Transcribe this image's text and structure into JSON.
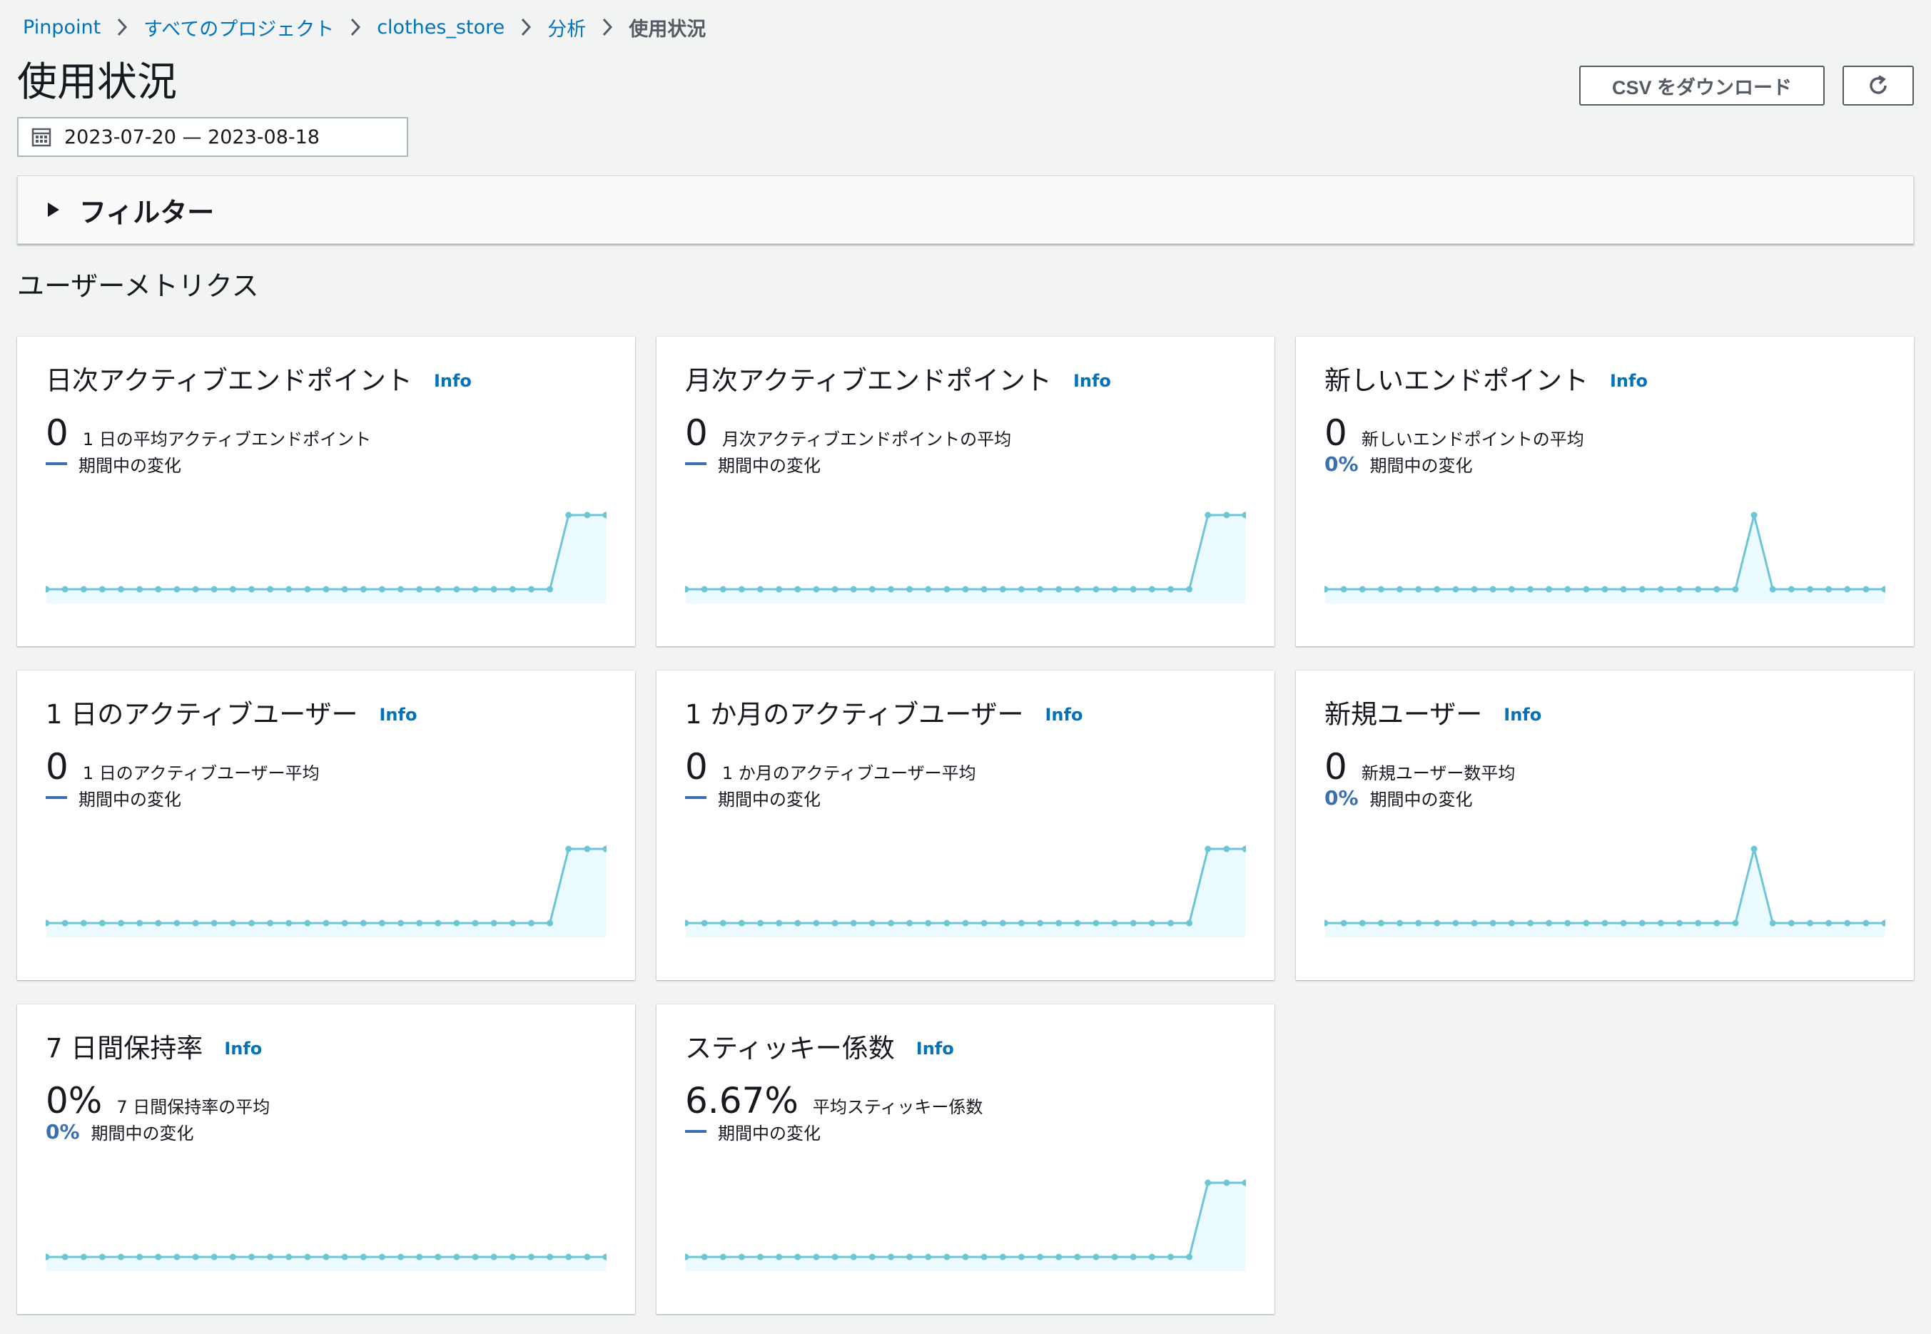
{
  "breadcrumb": [
    {
      "label": "Pinpoint"
    },
    {
      "label": "すべてのプロジェクト"
    },
    {
      "label": "clothes_store"
    },
    {
      "label": "分析"
    }
  ],
  "breadcrumb_current": "使用状況",
  "page_title": "使用状況",
  "buttons": {
    "csv": "CSV をダウンロード"
  },
  "date_range": "2023-07-20 — 2023-08-18",
  "filter_label": "フィルター",
  "section_title": "ユーザーメトリクス",
  "info_label": "Info",
  "colors": {
    "line": "#6cc6d6",
    "fill": "#eafaff",
    "accent": "#3a6fb0",
    "link": "#0073bb"
  },
  "cards": [
    {
      "title": "日次アクティブエンドポイント",
      "value": "0",
      "desc": "1 日の平均アクティブエンドポイント",
      "change": "",
      "change_label": "期間中の変化",
      "series": [
        0,
        0,
        0,
        0,
        0,
        0,
        0,
        0,
        0,
        0,
        0,
        0,
        0,
        0,
        0,
        0,
        0,
        0,
        0,
        0,
        0,
        0,
        0,
        0,
        0,
        0,
        0,
        0,
        1,
        1,
        1
      ]
    },
    {
      "title": "月次アクティブエンドポイント",
      "value": "0",
      "desc": "月次アクティブエンドポイントの平均",
      "change": "",
      "change_label": "期間中の変化",
      "series": [
        0,
        0,
        0,
        0,
        0,
        0,
        0,
        0,
        0,
        0,
        0,
        0,
        0,
        0,
        0,
        0,
        0,
        0,
        0,
        0,
        0,
        0,
        0,
        0,
        0,
        0,
        0,
        0,
        1,
        1,
        1
      ]
    },
    {
      "title": "新しいエンドポイント",
      "value": "0",
      "desc": "新しいエンドポイントの平均",
      "change": "0%",
      "change_label": "期間中の変化",
      "series": [
        0,
        0,
        0,
        0,
        0,
        0,
        0,
        0,
        0,
        0,
        0,
        0,
        0,
        0,
        0,
        0,
        0,
        0,
        0,
        0,
        0,
        0,
        0,
        1,
        0,
        0,
        0,
        0,
        0,
        0,
        0
      ]
    },
    {
      "title": "1 日のアクティブユーザー",
      "value": "0",
      "desc": "1 日のアクティブユーザー平均",
      "change": "",
      "change_label": "期間中の変化",
      "series": [
        0,
        0,
        0,
        0,
        0,
        0,
        0,
        0,
        0,
        0,
        0,
        0,
        0,
        0,
        0,
        0,
        0,
        0,
        0,
        0,
        0,
        0,
        0,
        0,
        0,
        0,
        0,
        0,
        1,
        1,
        1
      ]
    },
    {
      "title": "1 か月のアクティブユーザー",
      "value": "0",
      "desc": "1 か月のアクティブユーザー平均",
      "change": "",
      "change_label": "期間中の変化",
      "series": [
        0,
        0,
        0,
        0,
        0,
        0,
        0,
        0,
        0,
        0,
        0,
        0,
        0,
        0,
        0,
        0,
        0,
        0,
        0,
        0,
        0,
        0,
        0,
        0,
        0,
        0,
        0,
        0,
        1,
        1,
        1
      ]
    },
    {
      "title": "新規ユーザー",
      "value": "0",
      "desc": "新規ユーザー数平均",
      "change": "0%",
      "change_label": "期間中の変化",
      "series": [
        0,
        0,
        0,
        0,
        0,
        0,
        0,
        0,
        0,
        0,
        0,
        0,
        0,
        0,
        0,
        0,
        0,
        0,
        0,
        0,
        0,
        0,
        0,
        1,
        0,
        0,
        0,
        0,
        0,
        0,
        0
      ]
    },
    {
      "title": "7 日間保持率",
      "value": "0%",
      "desc": "7 日間保持率の平均",
      "change": "0%",
      "change_label": "期間中の変化",
      "series": [
        0,
        0,
        0,
        0,
        0,
        0,
        0,
        0,
        0,
        0,
        0,
        0,
        0,
        0,
        0,
        0,
        0,
        0,
        0,
        0,
        0,
        0,
        0,
        0,
        0,
        0,
        0,
        0,
        0,
        0,
        0
      ]
    },
    {
      "title": "スティッキー係数",
      "value": "6.67%",
      "desc": "平均スティッキー係数",
      "change": "",
      "change_label": "期間中の変化",
      "series": [
        0,
        0,
        0,
        0,
        0,
        0,
        0,
        0,
        0,
        0,
        0,
        0,
        0,
        0,
        0,
        0,
        0,
        0,
        0,
        0,
        0,
        0,
        0,
        0,
        0,
        0,
        0,
        0,
        1,
        1,
        1
      ]
    }
  ]
}
